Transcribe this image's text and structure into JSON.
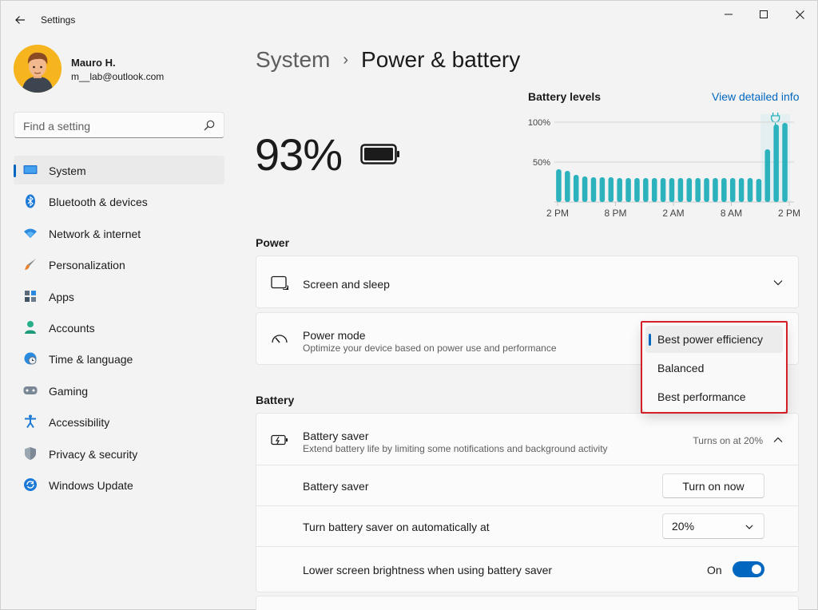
{
  "window": {
    "title": "Settings"
  },
  "profile": {
    "name": "Mauro H.",
    "email": "m__lab@outlook.com"
  },
  "search": {
    "placeholder": "Find a setting"
  },
  "sidebar": {
    "items": [
      {
        "label": "System",
        "icon": "monitor-icon",
        "selected": true
      },
      {
        "label": "Bluetooth & devices",
        "icon": "bluetooth-icon"
      },
      {
        "label": "Network & internet",
        "icon": "wifi-icon"
      },
      {
        "label": "Personalization",
        "icon": "brush-icon"
      },
      {
        "label": "Apps",
        "icon": "apps-icon"
      },
      {
        "label": "Accounts",
        "icon": "person-icon"
      },
      {
        "label": "Time & language",
        "icon": "globe-clock-icon"
      },
      {
        "label": "Gaming",
        "icon": "gamepad-icon"
      },
      {
        "label": "Accessibility",
        "icon": "accessibility-icon"
      },
      {
        "label": "Privacy & security",
        "icon": "shield-icon"
      },
      {
        "label": "Windows Update",
        "icon": "update-icon"
      }
    ]
  },
  "header": {
    "parent": "System",
    "separator": "›",
    "current": "Power & battery"
  },
  "battery": {
    "percent": "93%"
  },
  "battery_levels": {
    "title": "Battery levels",
    "link": "View detailed info",
    "y_ticks": [
      "100%",
      "50%"
    ],
    "x_ticks": [
      "2 PM",
      "8 PM",
      "2 AM",
      "8 AM",
      "2 PM"
    ]
  },
  "chart_data": {
    "type": "bar",
    "title": "Battery levels",
    "ylim": [
      0,
      100
    ],
    "ylabel": "",
    "xlabel": "",
    "y_ticks": [
      "100%",
      "50%"
    ],
    "x_ticks": [
      "2 PM",
      "8 PM",
      "2 AM",
      "8 AM",
      "2 PM"
    ],
    "values": [
      41,
      39,
      34,
      32,
      31,
      31,
      31,
      30,
      30,
      30,
      30,
      30,
      30,
      30,
      30,
      30,
      30,
      30,
      30,
      30,
      30,
      30,
      30,
      29,
      66,
      97,
      99
    ],
    "charging_bars": [
      24,
      25,
      26
    ],
    "color": "#2bb2bd"
  },
  "power": {
    "section_title": "Power",
    "screen_sleep": {
      "label": "Screen and sleep"
    },
    "power_mode": {
      "label": "Power mode",
      "sub": "Optimize your device based on power use and performance",
      "options": [
        "Best power efficiency",
        "Balanced",
        "Best performance"
      ],
      "selected": "Best power efficiency"
    }
  },
  "battery_section": {
    "section_title": "Battery",
    "saver": {
      "label": "Battery saver",
      "sub": "Extend battery life by limiting some notifications and background activity",
      "status": "Turns on at 20%"
    },
    "saver_row": {
      "label": "Battery saver",
      "button": "Turn on now"
    },
    "auto_row": {
      "label": "Turn battery saver on automatically at",
      "value": "20%"
    },
    "brightness_row": {
      "label": "Lower screen brightness when using battery saver",
      "state": "On",
      "on": true
    }
  },
  "colors": {
    "accent": "#0067c0",
    "chart": "#2bb2bd",
    "highlight": "#d32027"
  }
}
